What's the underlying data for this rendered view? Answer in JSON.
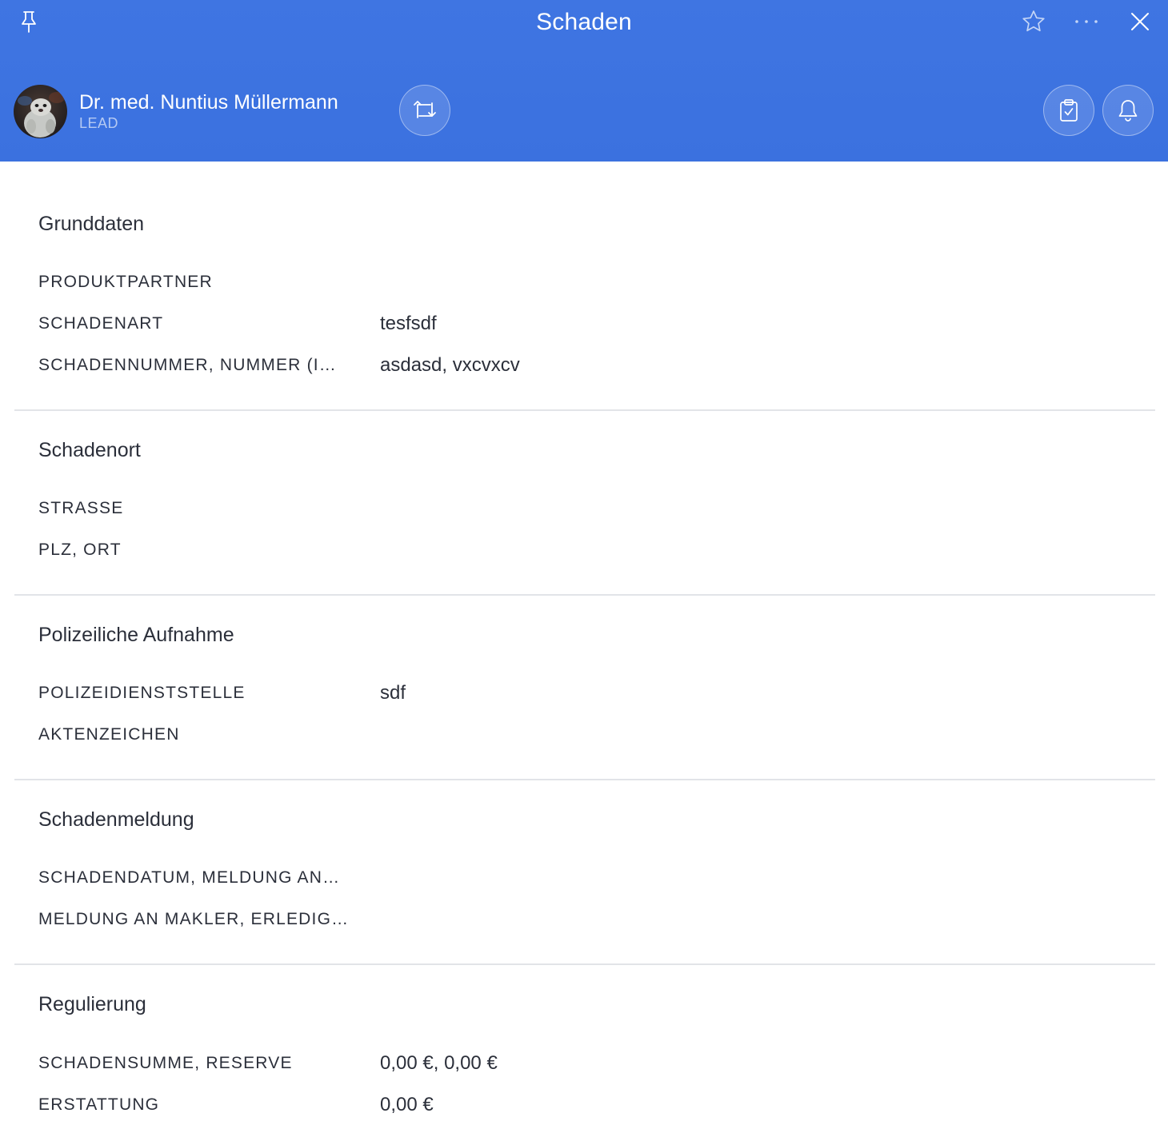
{
  "header": {
    "title": "Schaden",
    "icons": {
      "pin": "pin-icon",
      "favorite": "star-icon",
      "more": "more-icon",
      "close": "close-icon"
    },
    "contact": {
      "name": "Dr. med. Nuntius Müllermann",
      "role": "LEAD"
    },
    "actions": {
      "switch": "switch-icon",
      "tasks": "clipboard-check-icon",
      "reminders": "bell-icon"
    },
    "accent_color": "#3f75e2"
  },
  "sections": [
    {
      "title": "Grunddaten",
      "rows": [
        {
          "label": "PRODUKTPARTNER",
          "value": ""
        },
        {
          "label": "SCHADENART",
          "value": "tesfsdf"
        },
        {
          "label": "SCHADENNUMMER, NUMMER (I…",
          "value": "asdasd,  vxcvxcv"
        }
      ]
    },
    {
      "title": "Schadenort",
      "rows": [
        {
          "label": "STRASSE",
          "value": ""
        },
        {
          "label": "PLZ, ORT",
          "value": ""
        }
      ]
    },
    {
      "title": "Polizeiliche Aufnahme",
      "rows": [
        {
          "label": "POLIZEIDIENSTSTELLE",
          "value": "sdf"
        },
        {
          "label": "AKTENZEICHEN",
          "value": ""
        }
      ]
    },
    {
      "title": "Schadenmeldung",
      "rows": [
        {
          "label": "SCHADENDATUM, MELDUNG AN…",
          "value": ""
        },
        {
          "label": "MELDUNG AN MAKLER, ERLEDIG…",
          "value": ""
        }
      ]
    },
    {
      "title": "Regulierung",
      "rows": [
        {
          "label": "SCHADENSUMME, RESERVE",
          "value": "0,00 €,  0,00 €"
        },
        {
          "label": "ERSTATTUNG",
          "value": "0,00 €"
        }
      ]
    }
  ]
}
